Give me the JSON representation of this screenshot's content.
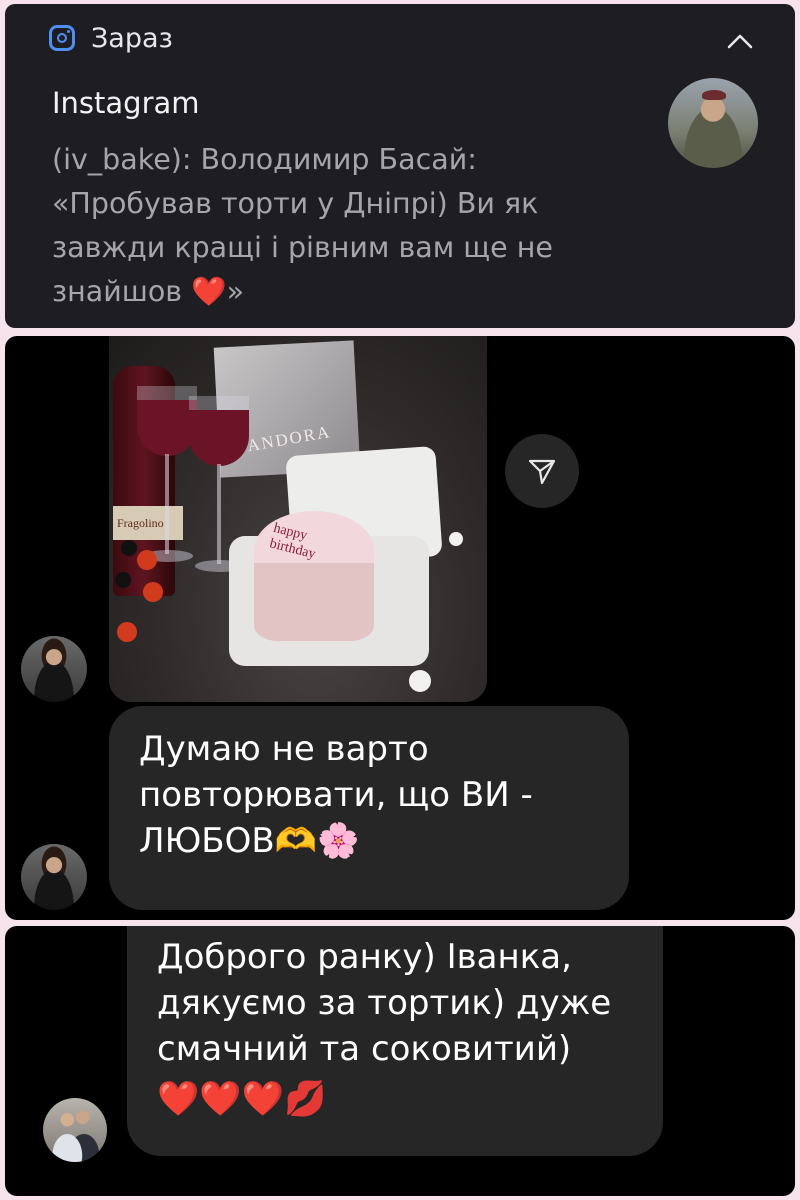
{
  "notification": {
    "time_label": "Зараз",
    "app_name": "Instagram",
    "body_text": "(iv_bake): Володимир Басай: «Пробував торти у Дніпрі) Ви як завжди кращі і рівним вам ще не знайшов",
    "body_heart": "❤️",
    "body_end": "»",
    "icons": [
      "instagram-icon",
      "chevron-up-icon"
    ]
  },
  "photo": {
    "bag_text": "PANDORA",
    "bottle_text": "Fragolino",
    "cake_text_line1": "happy",
    "cake_text_line2": "birthday"
  },
  "messages": {
    "message1_text": "Думаю не варто повторювати, що ВИ - ЛЮБОВ",
    "message1_emoji1": "🫶",
    "message1_emoji2": "🌸",
    "message2_text": "Доброго ранку) Іванка, дякуємо за тортик) дуже смачний та соковитий)",
    "message2_emoji": "❤️❤️❤️💋"
  },
  "colors": {
    "background": "#f7e3ec",
    "notification_bg": "#1e1d22",
    "chat_bg": "#000000",
    "bubble_bg": "#262626",
    "accent_icon": "#4f8ff0"
  }
}
